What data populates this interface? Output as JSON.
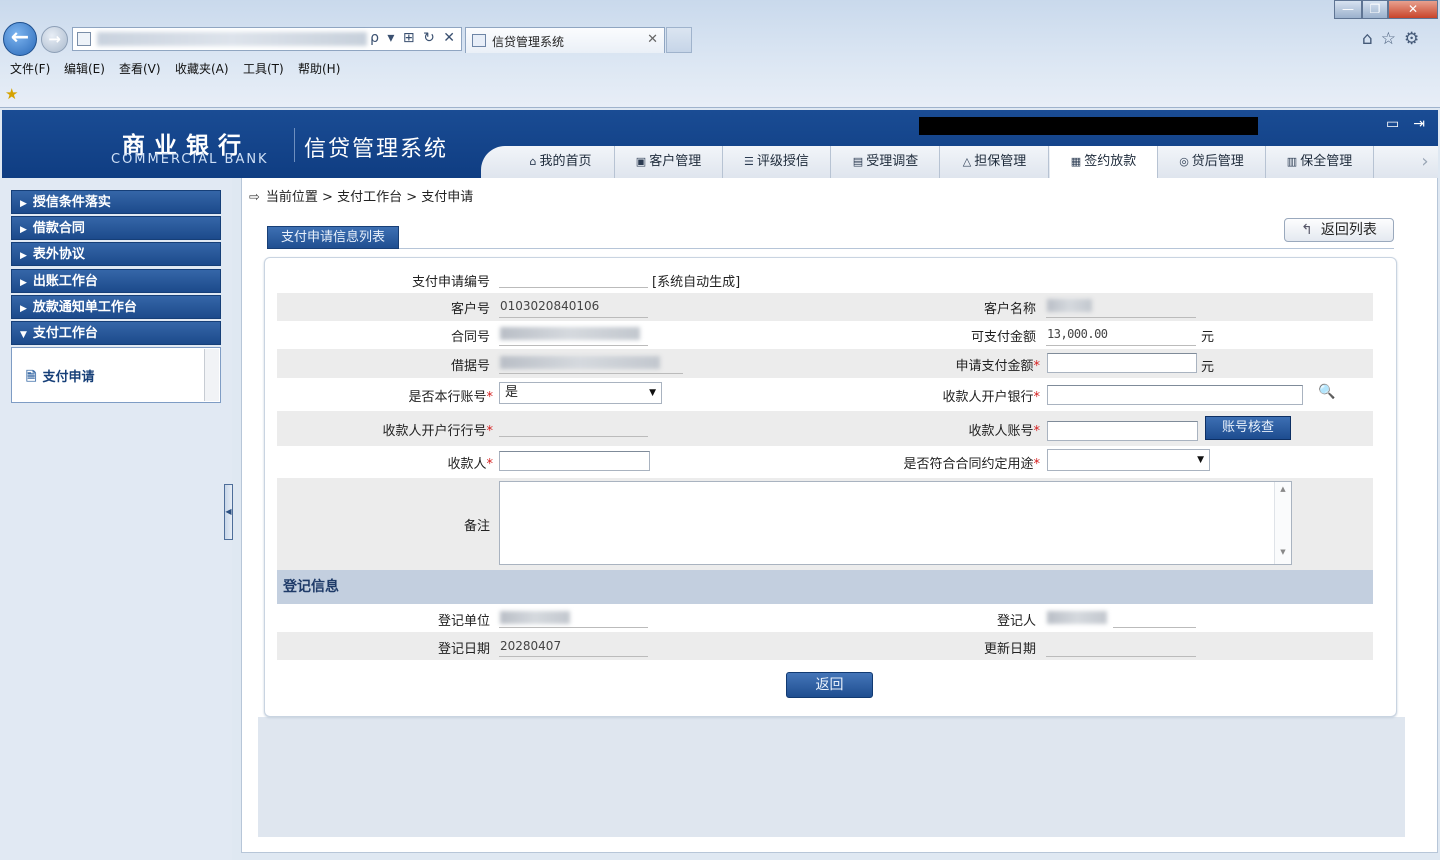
{
  "browser": {
    "tab_title": "信贷管理系统",
    "address_buttons": "ρ ▾ ⊞ ↻ ✕",
    "menu": [
      "文件(F)",
      "编辑(E)",
      "查看(V)",
      "收藏夹(A)",
      "工具(T)",
      "帮助(H)"
    ],
    "window_controls": {
      "min": "—",
      "max": "❐",
      "close": "✕"
    },
    "toolbar_icons": "⌂☆⚙",
    "fav_icon": "★"
  },
  "header": {
    "logo_cn": "商业银行",
    "logo_en": "COMMERCIAL BANK",
    "system_name": "信贷管理系统",
    "icons": "▭⇥"
  },
  "main_tabs": [
    {
      "label": "我的首页",
      "icon": "⌂"
    },
    {
      "label": "客户管理",
      "icon": "▣"
    },
    {
      "label": "评级授信",
      "icon": "☰"
    },
    {
      "label": "受理调查",
      "icon": "▤"
    },
    {
      "label": "担保管理",
      "icon": "△"
    },
    {
      "label": "签约放款",
      "icon": "▦",
      "active": true
    },
    {
      "label": "贷后管理",
      "icon": "◎"
    },
    {
      "label": "保全管理",
      "icon": "▥"
    }
  ],
  "tab_next": "›",
  "sidebar": {
    "items": [
      {
        "label": "授信条件落实",
        "arrow": "▶"
      },
      {
        "label": "借款合同",
        "arrow": "▶"
      },
      {
        "label": "表外协议",
        "arrow": "▶"
      },
      {
        "label": "出账工作台",
        "arrow": "▶"
      },
      {
        "label": "放款通知单工作台",
        "arrow": "▶"
      },
      {
        "label": "支付工作台",
        "arrow": "▼"
      }
    ],
    "sub_items": [
      {
        "label": "支付申请",
        "icon": "🗎"
      }
    ],
    "collapse": "◀"
  },
  "breadcrumb": {
    "icon": "⇨",
    "text": "当前位置 > 支付工作台 > 支付申请"
  },
  "list_tab": "支付申请信息列表",
  "back_to_list": {
    "icon": "↰",
    "label": "返回列表"
  },
  "form": {
    "pay_no_label": "支付申请编号",
    "pay_no_hint": "[系统自动生成]",
    "customer_no_label": "客户号",
    "customer_no": "0103020840106",
    "customer_name_label": "客户名称",
    "contract_no_label": "合同号",
    "payable_amount_label": "可支付金额",
    "payable_amount": "13,000.00",
    "unit": "元",
    "loan_no_label": "借据号",
    "apply_amount_label": "申请支付金额",
    "own_account_label": "是否本行账号",
    "own_account_value": "是",
    "payee_bank_label": "收款人开户银行",
    "payee_bank_no_label": "收款人开户行行号",
    "payee_account_label": "收款人账号",
    "verify_label": "账号核查",
    "payee_label": "收款人",
    "purpose_label": "是否符合合同约定用途",
    "remark_label": "备注",
    "required_mark": "*",
    "dropdown_arrow": "▼",
    "search_icon": "🔍",
    "scroll_up": "▲",
    "scroll_down": "▼"
  },
  "registration": {
    "section_title": "登记信息",
    "unit_label": "登记单位",
    "person_label": "登记人",
    "date_label": "登记日期",
    "date": "20280407",
    "update_label": "更新日期"
  },
  "back_button": "返回"
}
